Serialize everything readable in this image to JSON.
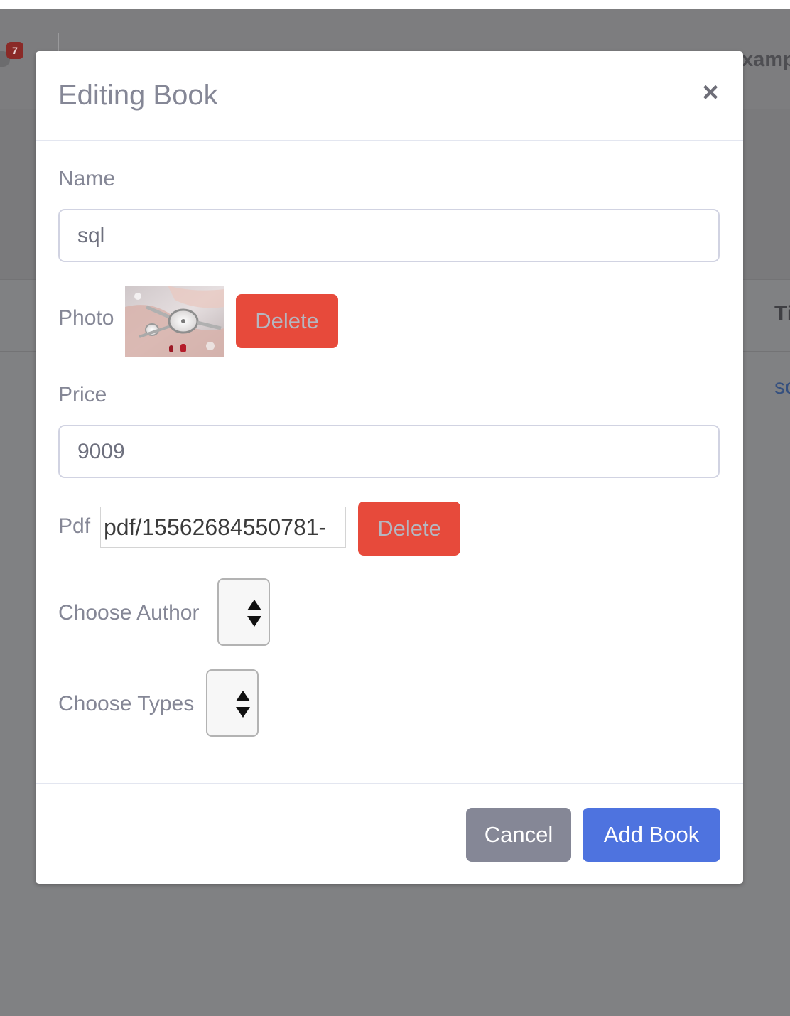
{
  "background": {
    "badge_count": "7",
    "topbar_text": "xamp",
    "table_column_header": "Ti",
    "table_cell_link": "sc"
  },
  "modal": {
    "title": "Editing Book",
    "close_symbol": "×",
    "fields": {
      "name": {
        "label": "Name",
        "value": "sql"
      },
      "photo": {
        "label": "Photo",
        "delete_label": "Delete",
        "thumbnail_icon": "wristwatch-photo"
      },
      "price": {
        "label": "Price",
        "value": "9009"
      },
      "pdf": {
        "label": "Pdf",
        "value": "pdf/15562684550781-",
        "delete_label": "Delete"
      },
      "author": {
        "label": "Choose Author",
        "selected": ""
      },
      "types": {
        "label": "Choose Types",
        "selected": ""
      }
    },
    "footer": {
      "cancel_label": "Cancel",
      "submit_label": "Add Book"
    }
  },
  "colors": {
    "backdrop": "#808183",
    "danger": "#e74a3b",
    "primary": "#4e73df",
    "secondary": "#858796",
    "label_text": "#858796"
  }
}
